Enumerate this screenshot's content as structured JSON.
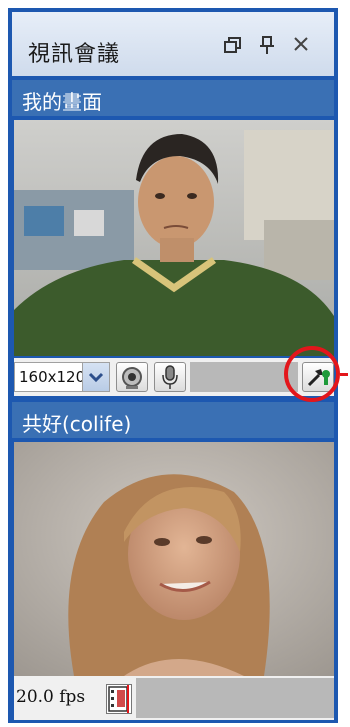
{
  "window": {
    "title": "視訊會議",
    "buttons": {
      "restore": "🗗",
      "pin": "📌",
      "close": "✕"
    }
  },
  "local": {
    "section_title": "我的畫面",
    "resolution": "160x120",
    "icons": [
      "camera-icon",
      "microphone-icon",
      "settings-tool-icon"
    ]
  },
  "remote": {
    "section_title": "共好(colife)",
    "fps": "20.0 fps",
    "icons": [
      "film-icon"
    ]
  },
  "colors": {
    "panel_blue": "#1d58b0",
    "section_blue": "#3a70b4",
    "highlight_red": "#e3161b"
  }
}
